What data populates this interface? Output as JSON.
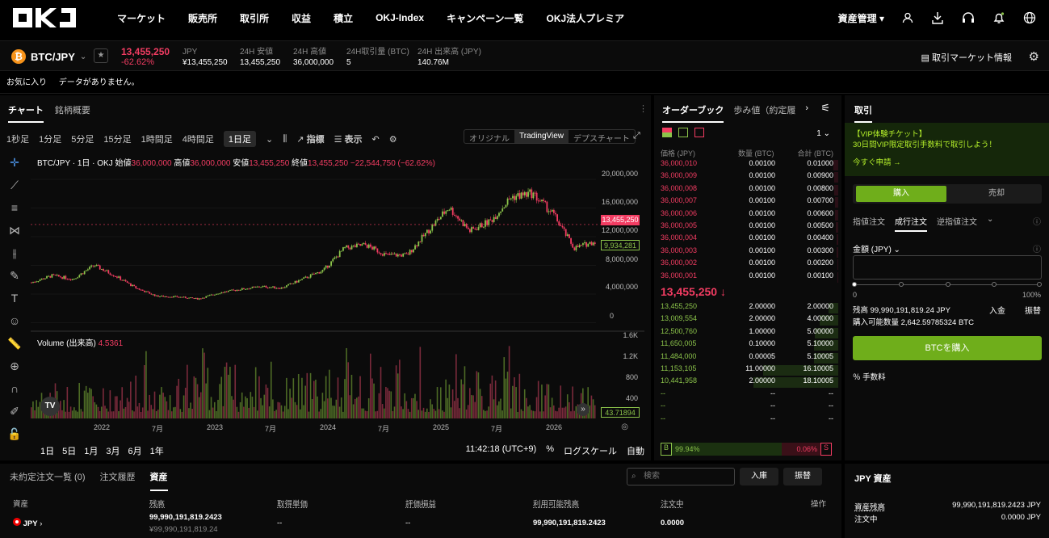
{
  "nav": {
    "logo": "OKJ",
    "menu": [
      "マーケット",
      "販売所",
      "取引所",
      "収益",
      "積立",
      "OKJ-Index",
      "キャンペーン一覧",
      "OKJ法人プレミア"
    ],
    "asset_label": "資産管理"
  },
  "ticker": {
    "pair": "BTC/JPY",
    "last": "13,455,250",
    "change": "-62.62%",
    "jpy_label": "JPY",
    "jpy_value": "¥13,455,250",
    "low_label": "24H 安値",
    "low_value": "13,455,250",
    "high_label": "24H 高値",
    "high_value": "36,000,000",
    "vol_btc_label": "24H取引量 (BTC)",
    "vol_btc_value": "5",
    "vol_jpy_label": "24H 出来高 (JPY)",
    "vol_jpy_value": "140.76M",
    "market_info": "取引マーケット情報"
  },
  "favorites": {
    "label": "お気に入り",
    "empty": "データがありません。"
  },
  "chart_tabs": [
    "チャート",
    "銘柄概要"
  ],
  "intervals": [
    "1秒足",
    "1分足",
    "5分足",
    "15分足",
    "1時間足",
    "4時間足",
    "1日足"
  ],
  "chart_tools": {
    "indicators": "指標",
    "display": "表示"
  },
  "view_switch": [
    "オリジナル",
    "TradingView",
    "デプスチャート"
  ],
  "ohlc": {
    "title": "BTC/JPY · 1日 · OKJ",
    "open_label": "始値",
    "open": "36,000,000",
    "high_label": "高値",
    "high": "36,000,000",
    "low_label": "安値",
    "low": "13,455,250",
    "close_label": "終値",
    "close": "13,455,250",
    "chg": "−22,544,750 (−62.62%)"
  },
  "volume": {
    "label": "Volume (出来高)",
    "value": "4.5361"
  },
  "chart_data": {
    "type": "line",
    "x": [
      "2021-09",
      "2021-11",
      "2022-01",
      "2022-03",
      "2022-05",
      "2022-07",
      "2022-09",
      "2022-11",
      "2023-01",
      "2023-03",
      "2023-05",
      "2023-07",
      "2023-09",
      "2023-11",
      "2024-01",
      "2024-03",
      "2024-05",
      "2024-07",
      "2024-09",
      "2024-11",
      "2025-01",
      "2025-03",
      "2025-05",
      "2025-07",
      "2025-09",
      "2025-11",
      "2026-01",
      "2026-02"
    ],
    "series": [
      {
        "values": [
          5000000,
          6000000,
          5500000,
          7500000,
          6000000,
          4200000,
          3000000,
          2900000,
          2600000,
          3500000,
          4000000,
          4400000,
          4200000,
          5500000,
          6800000,
          10000000,
          10500000,
          9000000,
          9000000,
          12500000,
          16000000,
          12500000,
          14000000,
          17500000,
          18000000,
          15000000,
          10000000,
          11000000
        ]
      }
    ],
    "price_axis": [
      "20,000,000",
      "16,000,000",
      "12,000,000",
      "8,000,000",
      "4,000,000",
      "0"
    ],
    "ylim": [
      0,
      21000000
    ],
    "last_tag": "13,455,250",
    "secondary_tag": "9,934,281",
    "volume_axis": [
      "1.6K",
      "1.2K",
      "800",
      "400"
    ],
    "volume_tag": "43.71894",
    "x_labels": [
      "2022",
      "7月",
      "2023",
      "7月",
      "2024",
      "7月",
      "2025",
      "7月",
      "2026"
    ]
  },
  "chart_bottom": {
    "ranges": [
      "1日",
      "5日",
      "1月",
      "3月",
      "6月",
      "1年"
    ],
    "time": "11:42:18 (UTC+9)",
    "pct": "%",
    "log": "ログスケール",
    "auto": "自動"
  },
  "orderbook": {
    "tabs": [
      "オーダーブック",
      "歩み値（約定履"
    ],
    "depth": "1",
    "headers": {
      "price": "価格 (JPY)",
      "qty": "数量 (BTC)",
      "total": "合計 (BTC)"
    },
    "asks": [
      [
        "36,000,010",
        "0.00100",
        "0.01000"
      ],
      [
        "36,000,009",
        "0.00100",
        "0.00900"
      ],
      [
        "36,000,008",
        "0.00100",
        "0.00800"
      ],
      [
        "36,000,007",
        "0.00100",
        "0.00700"
      ],
      [
        "36,000,006",
        "0.00100",
        "0.00600"
      ],
      [
        "36,000,005",
        "0.00100",
        "0.00500"
      ],
      [
        "36,000,004",
        "0.00100",
        "0.00400"
      ],
      [
        "36,000,003",
        "0.00100",
        "0.00300"
      ],
      [
        "36,000,002",
        "0.00100",
        "0.00200"
      ],
      [
        "36,000,001",
        "0.00100",
        "0.00100"
      ]
    ],
    "mid": "13,455,250 ↓",
    "bids": [
      [
        "13,455,250",
        "2.00000",
        "2.00000"
      ],
      [
        "13,009,554",
        "2.00000",
        "4.00000"
      ],
      [
        "12,500,760",
        "1.00000",
        "5.00000"
      ],
      [
        "11,650,005",
        "0.10000",
        "5.10000"
      ],
      [
        "11,484,000",
        "0.00005",
        "5.10005"
      ],
      [
        "11,153,105",
        "11.00000",
        "16.10005"
      ],
      [
        "10,441,958",
        "2.00000",
        "18.10005"
      ],
      [
        "--",
        "--",
        "--"
      ],
      [
        "--",
        "--",
        "--"
      ],
      [
        "--",
        "--",
        "--"
      ]
    ],
    "buy_pct": "99.94%",
    "sell_pct": "0.06%",
    "b_label": "B",
    "s_label": "S"
  },
  "trade": {
    "title": "取引",
    "vip_title": "【VIP体験チケット】",
    "vip_sub": "30日間VIP限定取引手数料で取引しよう！",
    "vip_link": "今すぐ申請 →",
    "buy": "購入",
    "sell": "売却",
    "order_types": [
      "指値注文",
      "成行注文",
      "逆指値注文"
    ],
    "amount_label": "金額 (JPY)",
    "pct_min": "0",
    "pct_max": "100%",
    "balance": "残高 99,990,191,819.24 JPY",
    "deposit": "入金",
    "transfer": "振替",
    "buyable": "購入可能数量 2,642.59785324 BTC",
    "buy_action": "BTCを購入",
    "fee": "％ 手数料"
  },
  "bottom": {
    "tabs": [
      "未約定注文一覧 (0)",
      "注文履歴",
      "資産"
    ],
    "search_placeholder": "検索",
    "deposit_btn": "入庫",
    "transfer_btn": "振替",
    "cols": [
      "資産",
      "残高",
      "取得単価",
      "評価損益",
      "利用可能残高",
      "注文中",
      "操作"
    ],
    "row": {
      "asset": "JPY",
      "balance": "99,990,191,819.2423",
      "balance_sub": "¥99,990,191,819.24",
      "cost": "--",
      "pnl": "--",
      "available": "99,990,191,819.2423",
      "ordering": "0.0000"
    }
  },
  "jpy_asset": {
    "title": "JPY 資産",
    "total_label": "資産残高",
    "total": "99,990,191,819.2423 JPY",
    "ordering_label": "注文中",
    "ordering": "0.0000 JPY"
  },
  "colors": {
    "accent": "#6fae1b",
    "red": "#f23c62",
    "green": "#8bc34a"
  }
}
